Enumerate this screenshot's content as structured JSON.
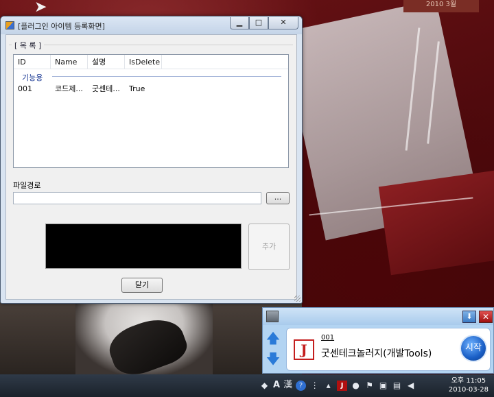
{
  "desktop": {
    "calendar_label": "2010 3월"
  },
  "dialog": {
    "title": "[플러그인 아이템 등록화면]",
    "controls": {
      "minimize": "▁",
      "maximize": "□",
      "close": "✕"
    },
    "group_label": "[ 목 록 ]",
    "list": {
      "columns": [
        "ID",
        "Name",
        "설명",
        "IsDelete"
      ],
      "group_name": "기능용",
      "rows": [
        {
          "id": "001",
          "name": "코드제...",
          "desc": "굿센테...",
          "is_delete": "True"
        }
      ]
    },
    "path_label": "파일경로",
    "path_value": "",
    "browse_label": "...",
    "add_label": "추가",
    "close_label": "닫기"
  },
  "launcher": {
    "item_code": "001",
    "item_name": "굿센테크놀러지(개발Tools)",
    "logo_glyph": "J",
    "start_label": "시작",
    "download_glyph": "⬇",
    "close_glyph": "✕",
    "up_glyph": "🡅",
    "down_glyph": "🡇"
  },
  "taskbar": {
    "tray_items": [
      "A",
      "漢"
    ],
    "time": "오후 11:05",
    "date": "2010-03-28"
  },
  "colors": {
    "title_blue": "#c4d4e8",
    "group_blue": "#1e3c96",
    "launcher_blue": "#b3d4f2",
    "start_blue": "#1a5fc6",
    "logo_red": "#c41e1e"
  }
}
